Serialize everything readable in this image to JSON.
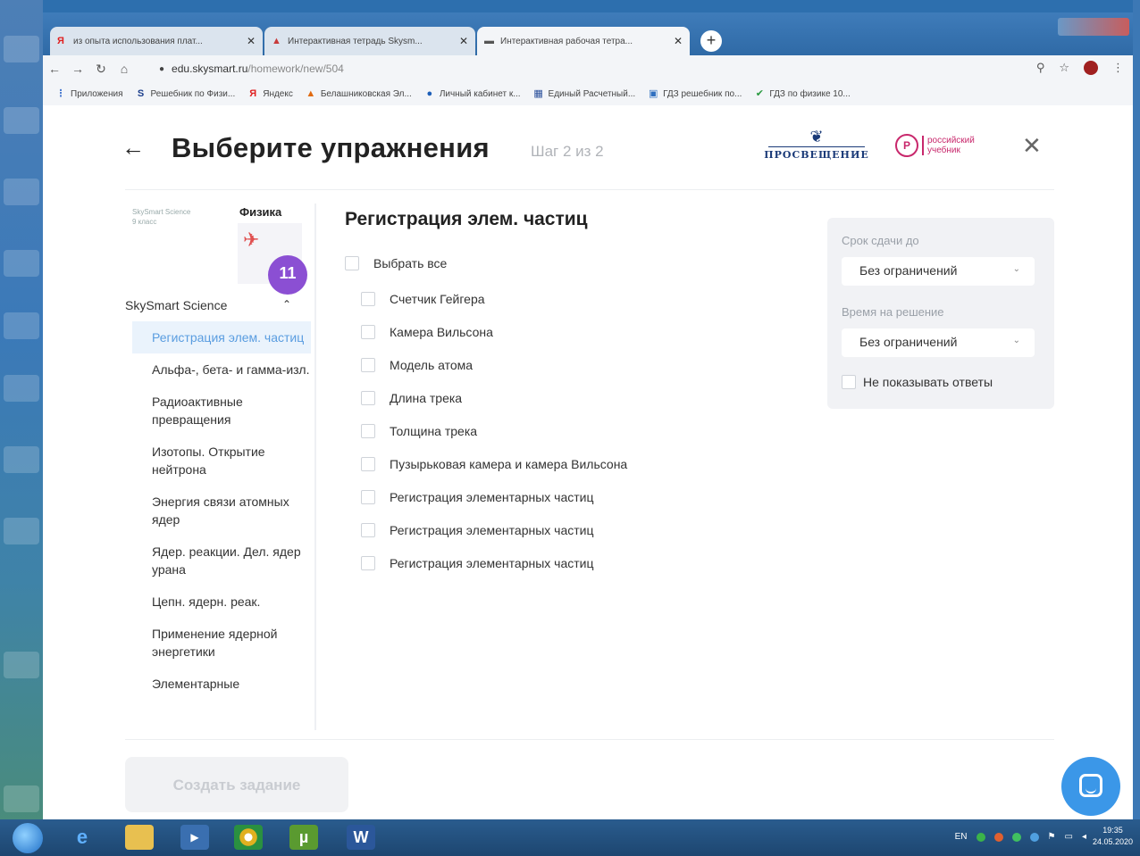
{
  "browser": {
    "tabs": [
      {
        "title": "из опыта использования плат...",
        "icon": "yandex-icon",
        "active": false
      },
      {
        "title": "Интерактивная тетрадь Skysm...",
        "icon": "skysmart-icon",
        "active": false
      },
      {
        "title": "Интерактивная рабочая тетра...",
        "icon": "page-icon",
        "active": true
      }
    ],
    "url_host": "edu.skysmart.ru",
    "url_path": "/homework/new/504",
    "bookmarks": [
      {
        "label": "Приложения",
        "icon": "apps-icon"
      },
      {
        "label": "Решебник по Физи...",
        "icon": "st-icon"
      },
      {
        "label": "Яндекс",
        "icon": "yandex-icon"
      },
      {
        "label": "Белашниковская Эл...",
        "icon": "bookmark-icon"
      },
      {
        "label": "Личный кабинет к...",
        "icon": "bookmark-icon"
      },
      {
        "label": "Единый Расчетный...",
        "icon": "bookmark-icon"
      },
      {
        "label": "ГДЗ решебник по...",
        "icon": "bookmark-icon"
      },
      {
        "label": "ГДЗ по физике 10...",
        "icon": "check-icon"
      }
    ]
  },
  "header": {
    "title": "Выберите упражнения",
    "step": "Шаг 2 из 2",
    "publisher_logo": "ПРОСВЕЩЕНИЕ",
    "partner_logo_line1": "российский",
    "partner_logo_line2": "учебник"
  },
  "sidebar": {
    "book_publisher": "SkySmart Science",
    "book_grade": "9 класс",
    "book_subject": "Физика",
    "book_badge": "11",
    "series": "SkySmart Science",
    "items": [
      {
        "label": "Регистрация элем. частиц",
        "active": true
      },
      {
        "label": "Альфа-, бета- и гамма-изл.",
        "active": false
      },
      {
        "label": "Радиоактивные превращения",
        "active": false
      },
      {
        "label": "Изотопы. Открытие нейтрона",
        "active": false
      },
      {
        "label": "Энергия связи атомных ядер",
        "active": false
      },
      {
        "label": "Ядер. реакции. Дел. ядер урана",
        "active": false
      },
      {
        "label": "Цепн. ядерн. реак.",
        "active": false
      },
      {
        "label": "Применение ядерной энергетики",
        "active": false
      },
      {
        "label": "Элементарные",
        "active": false
      }
    ]
  },
  "main": {
    "section_title": "Регистрация элем. частиц",
    "select_all": "Выбрать все",
    "exercises": [
      "Счетчик Гейгера",
      "Камера Вильсона",
      "Модель атома",
      "Длина трека",
      "Толщина трека",
      "Пузырьковая камера и камера Вильсона",
      "Регистрация элементарных частиц",
      "Регистрация элементарных частиц",
      "Регистрация элементарных частиц"
    ]
  },
  "settings": {
    "deadline_label": "Срок сдачи до",
    "deadline_value": "Без ограничений",
    "time_label": "Время на решение",
    "time_value": "Без ограничений",
    "hide_answers": "Не показывать ответы"
  },
  "footer": {
    "create_button": "Создать задание"
  },
  "taskbar": {
    "lang": "EN",
    "time": "19:35",
    "date": "24.05.2020"
  }
}
